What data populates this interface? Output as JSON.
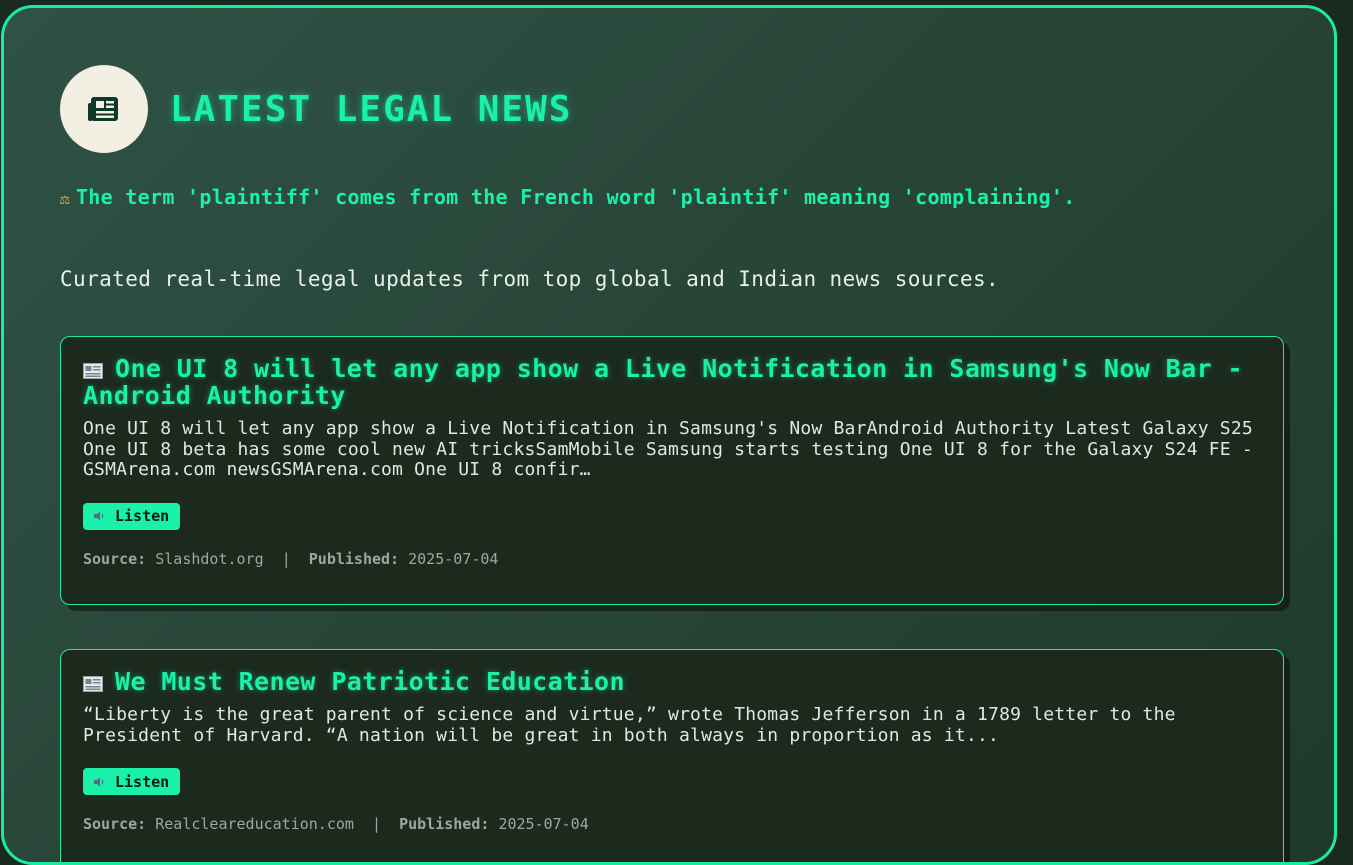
{
  "page": {
    "title": "LATEST LEGAL NEWS",
    "logo_icon": "newspaper-icon",
    "fact_icon": "balance-scale-icon",
    "fact": "The term 'plaintiff' comes from the French word 'plaintif' meaning 'complaining'.",
    "subtitle": "Curated real-time legal updates from top global and Indian news sources."
  },
  "articles": [
    {
      "icon": "newspaper-icon",
      "title": "One UI 8 will let any app show a Live Notification in Samsung's Now Bar - Android Authority",
      "description": "One UI 8 will let any app show a Live Notification in Samsung's Now BarAndroid Authority Latest Galaxy S25 One UI 8 beta has some cool new AI tricksSamMobile Samsung starts testing One UI 8 for the Galaxy S24 FE - GSMArena.com newsGSMArena.com One UI 8 confir…",
      "listen_label": "Listen",
      "source_label": "Source:",
      "source": "Slashdot.org",
      "separator": "|",
      "published_label": "Published:",
      "published": "2025-07-04"
    },
    {
      "icon": "newspaper-icon",
      "title": "We Must Renew Patriotic Education",
      "description": "“Liberty is the great parent of science and virtue,” wrote Thomas Jefferson in a 1789 letter to the President of Harvard. “A nation will be great in both always in proportion as it...",
      "listen_label": "Listen",
      "source_label": "Source:",
      "source": "Realcleareducation.com",
      "separator": "|",
      "published_label": "Published:",
      "published": "2025-07-04"
    }
  ],
  "colors": {
    "accent": "#19f0a8",
    "card_bg": "#1c2a1e",
    "page_bg": "#284638",
    "logo_bg": "#f3efe2"
  }
}
